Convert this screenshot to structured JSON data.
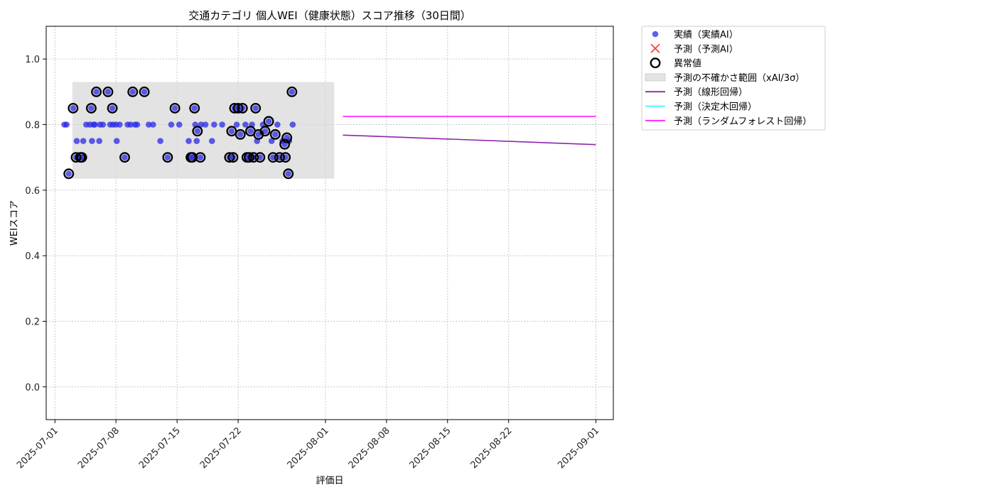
{
  "chart_data": {
    "type": "scatter",
    "title": "交通カテゴリ 個人WEI（健康状態）スコア推移（30日間）",
    "xlabel": "評価日",
    "ylabel": "WEIスコア",
    "xlim": [
      "2025-06-30",
      "2025-09-03"
    ],
    "ylim": [
      -0.1,
      1.1
    ],
    "x_ticks": [
      "2025-07-01",
      "2025-07-08",
      "2025-07-15",
      "2025-07-22",
      "2025-08-01",
      "2025-08-08",
      "2025-08-15",
      "2025-08-22",
      "2025-09-01"
    ],
    "y_ticks": [
      0.0,
      0.2,
      0.4,
      0.6,
      0.8,
      1.0
    ],
    "grid": true,
    "legend_position": "outside-upper-right",
    "series": [
      {
        "name": "実績（実績AI）",
        "kind": "scatter",
        "color": "#2a2ae6",
        "points": [
          [
            "2025-07-02 02:00",
            0.8
          ],
          [
            "2025-07-02 08:00",
            0.8
          ],
          [
            "2025-07-02 14:00",
            0.65
          ],
          [
            "2025-07-03 02:00",
            0.85
          ],
          [
            "2025-07-03 10:00",
            0.7
          ],
          [
            "2025-07-03 12:00",
            0.75
          ],
          [
            "2025-07-03 22:00",
            0.7
          ],
          [
            "2025-07-04 02:00",
            0.7
          ],
          [
            "2025-07-04 06:00",
            0.75
          ],
          [
            "2025-07-04 14:00",
            0.8
          ],
          [
            "2025-07-05 00:00",
            0.8
          ],
          [
            "2025-07-05 04:00",
            0.85
          ],
          [
            "2025-07-05 06:00",
            0.75
          ],
          [
            "2025-07-05 10:00",
            0.8
          ],
          [
            "2025-07-05 14:00",
            0.8
          ],
          [
            "2025-07-05 18:00",
            0.9
          ],
          [
            "2025-07-06 02:00",
            0.75
          ],
          [
            "2025-07-06 04:00",
            0.8
          ],
          [
            "2025-07-06 12:00",
            0.8
          ],
          [
            "2025-07-07 02:00",
            0.9
          ],
          [
            "2025-07-07 08:00",
            0.8
          ],
          [
            "2025-07-07 14:00",
            0.85
          ],
          [
            "2025-07-07 16:00",
            0.8
          ],
          [
            "2025-07-08 00:00",
            0.8
          ],
          [
            "2025-07-08 02:00",
            0.75
          ],
          [
            "2025-07-08 10:00",
            0.8
          ],
          [
            "2025-07-09 00:00",
            0.7
          ],
          [
            "2025-07-09 08:00",
            0.8
          ],
          [
            "2025-07-09 16:00",
            0.8
          ],
          [
            "2025-07-09 22:00",
            0.9
          ],
          [
            "2025-07-10 04:00",
            0.8
          ],
          [
            "2025-07-10 10:00",
            0.8
          ],
          [
            "2025-07-11 06:00",
            0.9
          ],
          [
            "2025-07-11 18:00",
            0.8
          ],
          [
            "2025-07-12 06:00",
            0.8
          ],
          [
            "2025-07-13 02:00",
            0.75
          ],
          [
            "2025-07-13 22:00",
            0.7
          ],
          [
            "2025-07-14 08:00",
            0.8
          ],
          [
            "2025-07-14 18:00",
            0.85
          ],
          [
            "2025-07-15 06:00",
            0.8
          ],
          [
            "2025-07-16 08:00",
            0.75
          ],
          [
            "2025-07-16 14:00",
            0.7
          ],
          [
            "2025-07-16 18:00",
            0.7
          ],
          [
            "2025-07-17 00:00",
            0.85
          ],
          [
            "2025-07-17 02:00",
            0.8
          ],
          [
            "2025-07-17 06:00",
            0.75
          ],
          [
            "2025-07-17 08:00",
            0.78
          ],
          [
            "2025-07-17 16:00",
            0.7
          ],
          [
            "2025-07-17 18:00",
            0.8
          ],
          [
            "2025-07-18 06:00",
            0.8
          ],
          [
            "2025-07-19 00:00",
            0.75
          ],
          [
            "2025-07-19 06:00",
            0.8
          ],
          [
            "2025-07-20 04:00",
            0.8
          ],
          [
            "2025-07-21 00:00",
            0.7
          ],
          [
            "2025-07-21 06:00",
            0.78
          ],
          [
            "2025-07-21 10:00",
            0.7
          ],
          [
            "2025-07-21 14:00",
            0.85
          ],
          [
            "2025-07-21 20:00",
            0.8
          ],
          [
            "2025-07-22 00:00",
            0.85
          ],
          [
            "2025-07-22 06:00",
            0.77
          ],
          [
            "2025-07-22 12:00",
            0.85
          ],
          [
            "2025-07-22 20:00",
            0.8
          ],
          [
            "2025-07-23 00:00",
            0.7
          ],
          [
            "2025-07-23 06:00",
            0.7
          ],
          [
            "2025-07-23 10:00",
            0.78
          ],
          [
            "2025-07-23 14:00",
            0.8
          ],
          [
            "2025-07-23 18:00",
            0.7
          ],
          [
            "2025-07-24 00:00",
            0.85
          ],
          [
            "2025-07-24 04:00",
            0.75
          ],
          [
            "2025-07-24 08:00",
            0.77
          ],
          [
            "2025-07-24 12:00",
            0.7
          ],
          [
            "2025-07-24 20:00",
            0.8
          ],
          [
            "2025-07-25 02:00",
            0.78
          ],
          [
            "2025-07-25 12:00",
            0.81
          ],
          [
            "2025-07-25 20:00",
            0.75
          ],
          [
            "2025-07-26 00:00",
            0.7
          ],
          [
            "2025-07-26 06:00",
            0.77
          ],
          [
            "2025-07-26 12:00",
            0.8
          ],
          [
            "2025-07-26 18:00",
            0.7
          ],
          [
            "2025-07-27 02:00",
            0.75
          ],
          [
            "2025-07-27 08:00",
            0.74
          ],
          [
            "2025-07-27 10:00",
            0.7
          ],
          [
            "2025-07-27 14:00",
            0.76
          ],
          [
            "2025-07-27 18:00",
            0.65
          ],
          [
            "2025-07-27 20:00",
            0.75
          ],
          [
            "2025-07-28 04:00",
            0.9
          ],
          [
            "2025-07-28 06:00",
            0.8
          ]
        ]
      },
      {
        "name": "予測（予測AI）",
        "kind": "scatter",
        "marker": "x",
        "color": "#ff4040",
        "points": []
      },
      {
        "name": "異常値",
        "kind": "scatter",
        "marker": "ring",
        "color": "#000000",
        "points": [
          [
            "2025-07-02 14:00",
            0.65
          ],
          [
            "2025-07-03 02:00",
            0.85
          ],
          [
            "2025-07-03 10:00",
            0.7
          ],
          [
            "2025-07-03 22:00",
            0.7
          ],
          [
            "2025-07-04 02:00",
            0.7
          ],
          [
            "2025-07-05 04:00",
            0.85
          ],
          [
            "2025-07-05 18:00",
            0.9
          ],
          [
            "2025-07-07 02:00",
            0.9
          ],
          [
            "2025-07-07 14:00",
            0.85
          ],
          [
            "2025-07-09 00:00",
            0.7
          ],
          [
            "2025-07-09 22:00",
            0.9
          ],
          [
            "2025-07-11 06:00",
            0.9
          ],
          [
            "2025-07-13 22:00",
            0.7
          ],
          [
            "2025-07-14 18:00",
            0.85
          ],
          [
            "2025-07-16 14:00",
            0.7
          ],
          [
            "2025-07-16 18:00",
            0.7
          ],
          [
            "2025-07-17 00:00",
            0.85
          ],
          [
            "2025-07-17 08:00",
            0.78
          ],
          [
            "2025-07-17 16:00",
            0.7
          ],
          [
            "2025-07-21 00:00",
            0.7
          ],
          [
            "2025-07-21 06:00",
            0.78
          ],
          [
            "2025-07-21 10:00",
            0.7
          ],
          [
            "2025-07-21 14:00",
            0.85
          ],
          [
            "2025-07-22 00:00",
            0.85
          ],
          [
            "2025-07-22 06:00",
            0.77
          ],
          [
            "2025-07-22 12:00",
            0.85
          ],
          [
            "2025-07-23 00:00",
            0.7
          ],
          [
            "2025-07-23 06:00",
            0.7
          ],
          [
            "2025-07-23 10:00",
            0.78
          ],
          [
            "2025-07-23 18:00",
            0.7
          ],
          [
            "2025-07-24 00:00",
            0.85
          ],
          [
            "2025-07-24 08:00",
            0.77
          ],
          [
            "2025-07-24 12:00",
            0.7
          ],
          [
            "2025-07-25 02:00",
            0.78
          ],
          [
            "2025-07-25 12:00",
            0.81
          ],
          [
            "2025-07-26 00:00",
            0.7
          ],
          [
            "2025-07-26 06:00",
            0.77
          ],
          [
            "2025-07-26 18:00",
            0.7
          ],
          [
            "2025-07-27 08:00",
            0.74
          ],
          [
            "2025-07-27 10:00",
            0.7
          ],
          [
            "2025-07-27 14:00",
            0.76
          ],
          [
            "2025-07-27 18:00",
            0.65
          ],
          [
            "2025-07-28 04:00",
            0.9
          ]
        ]
      },
      {
        "name": "予測の不確かさ範囲（xAI/3σ）",
        "kind": "band",
        "color": "#d9d9d9",
        "x": [
          "2025-07-03",
          "2025-08-02"
        ],
        "y_low": 0.635,
        "y_high": 0.93
      },
      {
        "name": "予測（線形回帰）",
        "kind": "line",
        "color": "#8e24aa",
        "points": [
          [
            "2025-08-03",
            0.768
          ],
          [
            "2025-09-01",
            0.739
          ]
        ]
      },
      {
        "name": "予測（決定木回帰）",
        "kind": "line",
        "color": "#33ffff",
        "points": []
      },
      {
        "name": "予測（ランダムフォレスト回帰）",
        "kind": "line",
        "color": "#ff22ff",
        "points": [
          [
            "2025-08-03",
            0.825
          ],
          [
            "2025-09-01",
            0.825
          ]
        ]
      }
    ]
  }
}
